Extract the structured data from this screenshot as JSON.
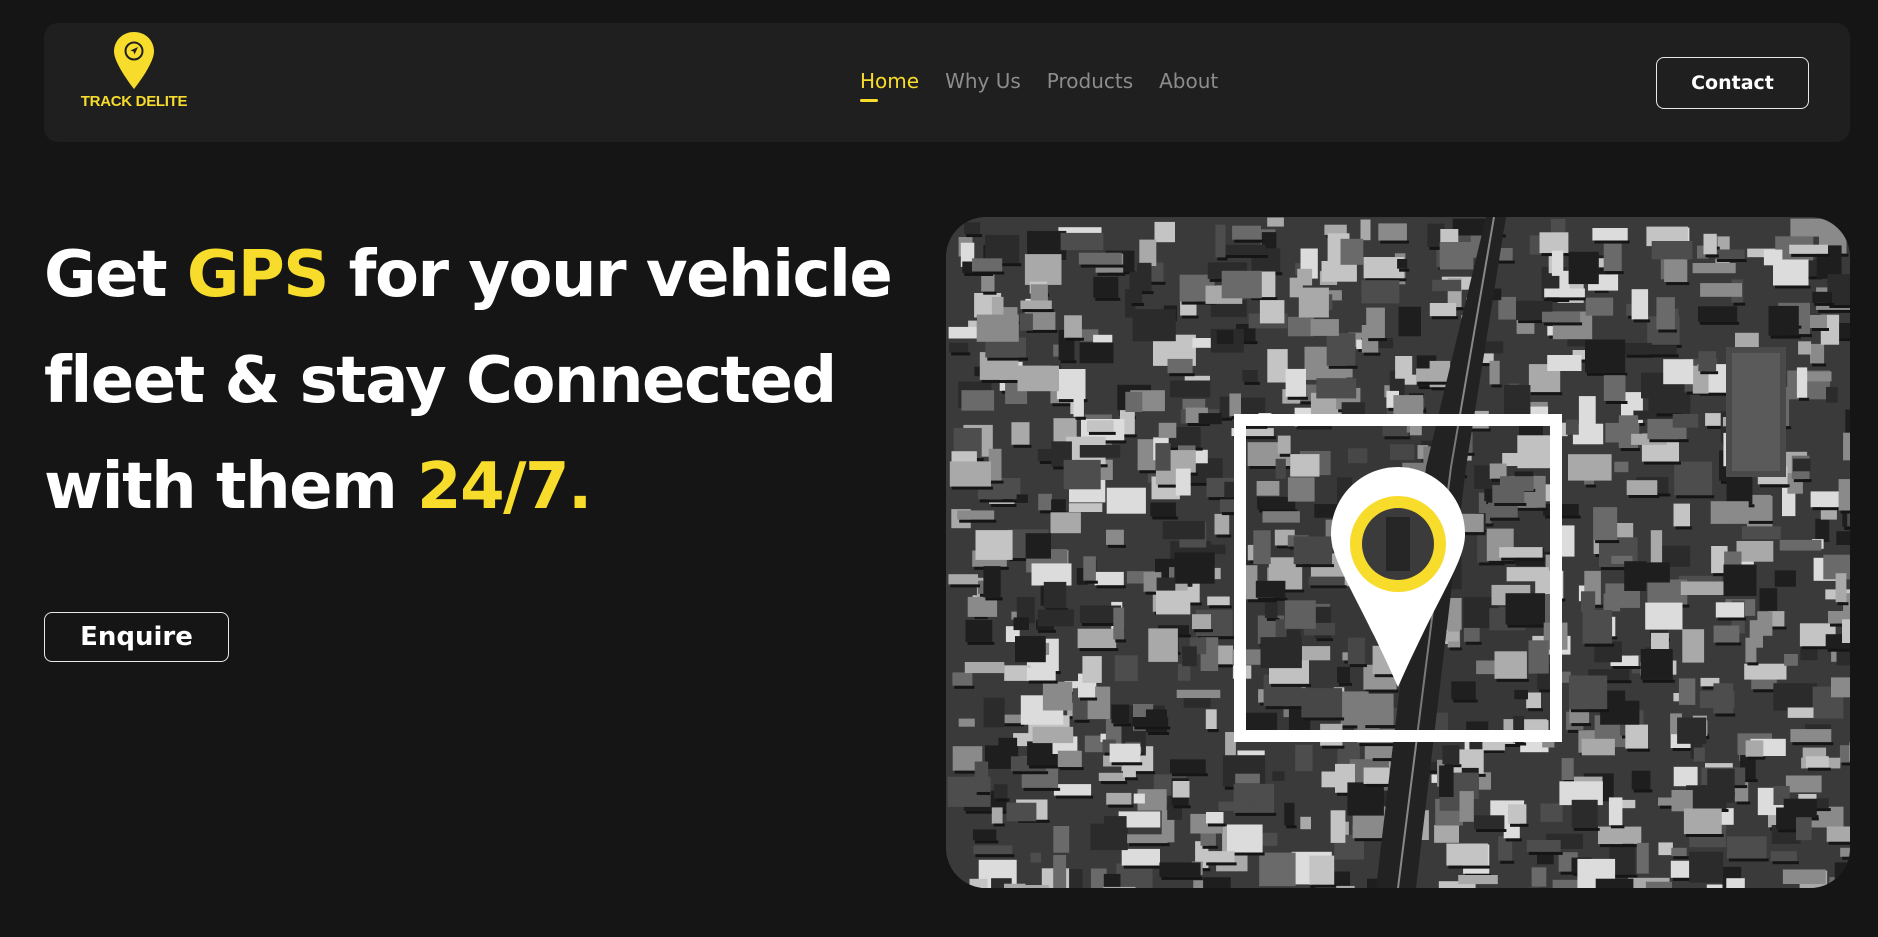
{
  "brand": {
    "name": "TRACK DELITE",
    "accent_color": "#f8dc2c",
    "logo_icon": "map-pin-navigation-icon"
  },
  "nav": {
    "items": [
      {
        "label": "Home",
        "active": true
      },
      {
        "label": "Why Us",
        "active": false
      },
      {
        "label": "Products",
        "active": false
      },
      {
        "label": "About",
        "active": false
      }
    ],
    "contact_label": "Contact"
  },
  "hero": {
    "title_parts": [
      {
        "text": "Get ",
        "highlight": false
      },
      {
        "text": "GPS",
        "highlight": true
      },
      {
        "text": " for your vehicle fleet & stay Connected with them ",
        "highlight": false
      },
      {
        "text": "24/7.",
        "highlight": true
      }
    ],
    "cta_label": "Enquire",
    "image": {
      "description_icon": "location-pin-icon",
      "frame_color": "#ffffff",
      "ring_color": "#f8dc2c"
    }
  }
}
